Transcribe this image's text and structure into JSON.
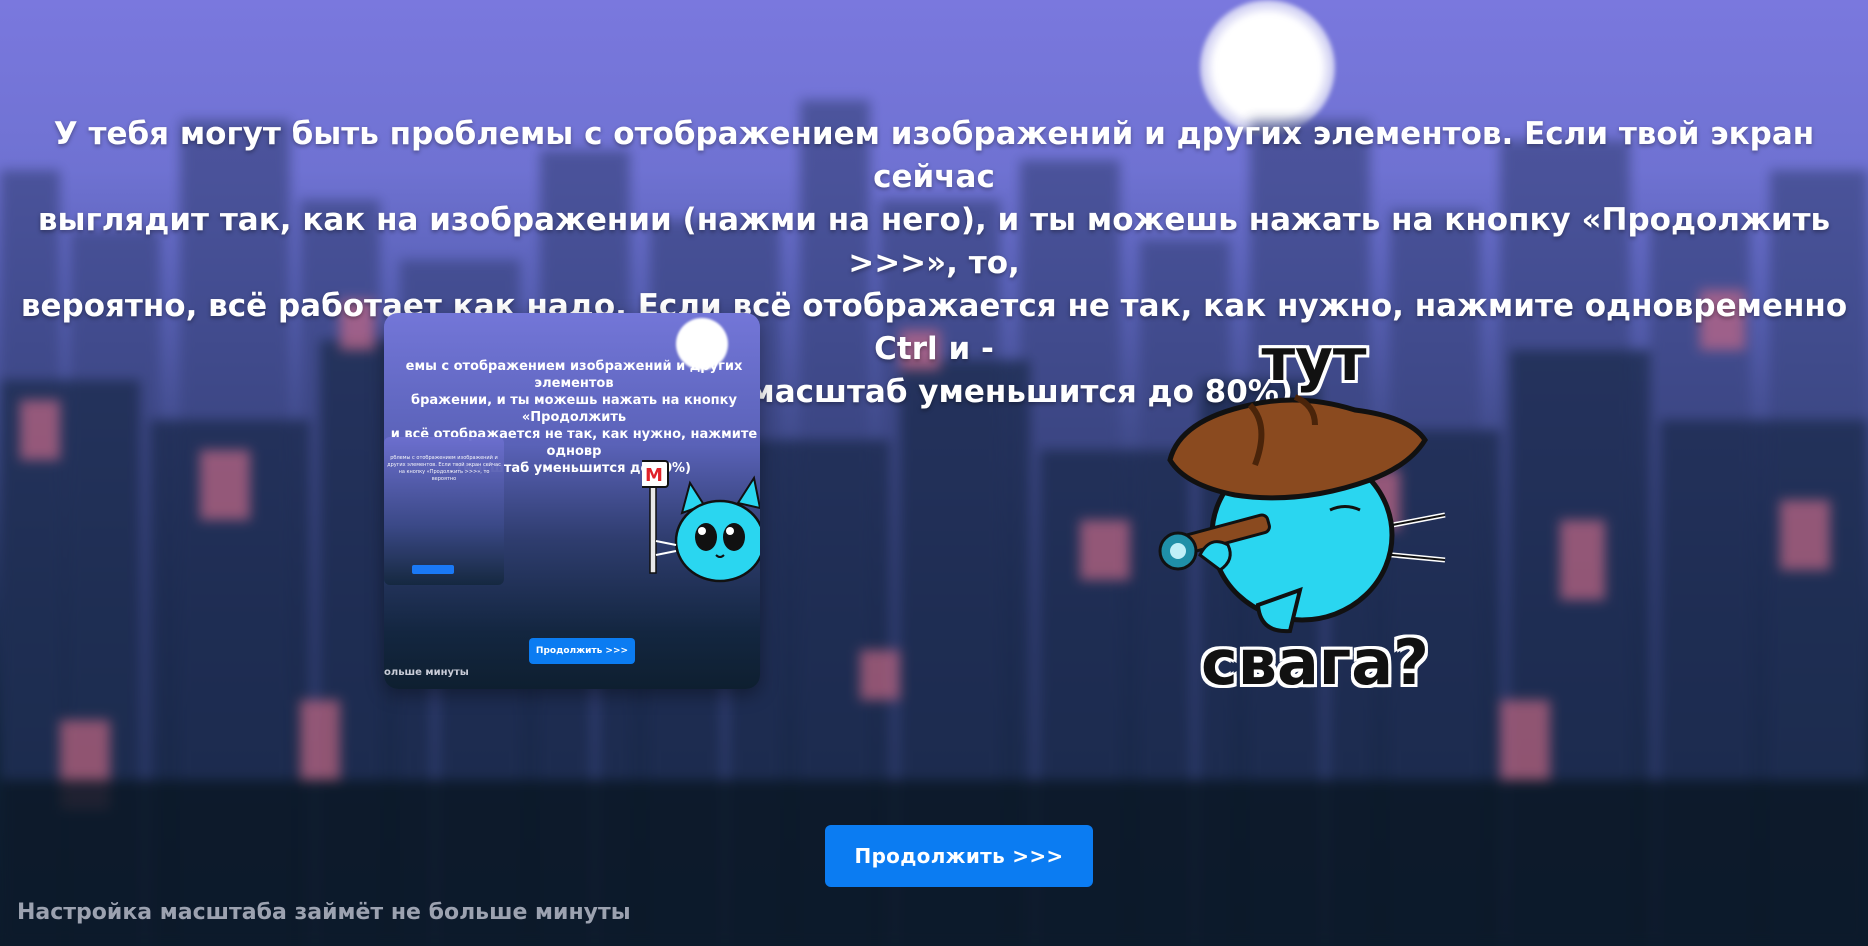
{
  "headline": "У тебя могут быть проблемы с отображением изображений и других элементов. Если твой экран сейчас\nвыглядит так, как на изображении (нажми на него), и ты можешь нажать на кнопку «Продолжить >>>», то,\nвероятно, всё работает как надо. Если всё отображается не так, как нужно, нажмите одновременно Ctrl и -\nдважды (масштаб уменьшится до 80%)",
  "preview": {
    "text": "емы с отображением изображений и других элементов\nбражении, и ты можешь нажать на кнопку «Продолжить\nи всё отображается не так, как нужно, нажмите одновр\n(масштаб уменьшится до 80%)",
    "inner_text": "рблемы с отображением изображений и других элементов. Если твой экран сейчас на кнопку «Продолжить >>>», то вероятно",
    "button_label": "Продолжить >>>",
    "footer": "ольше минуты",
    "metro_sign": "М"
  },
  "sticker": {
    "top_text": "тут",
    "bottom_text": "свага?"
  },
  "continue_button": "Продолжить >>>",
  "footer_note": "Настройка масштаба займёт не больше минуты",
  "colors": {
    "accent": "#0b7cf2",
    "cat": "#2ad6f0",
    "hat": "#8a4a1f"
  }
}
